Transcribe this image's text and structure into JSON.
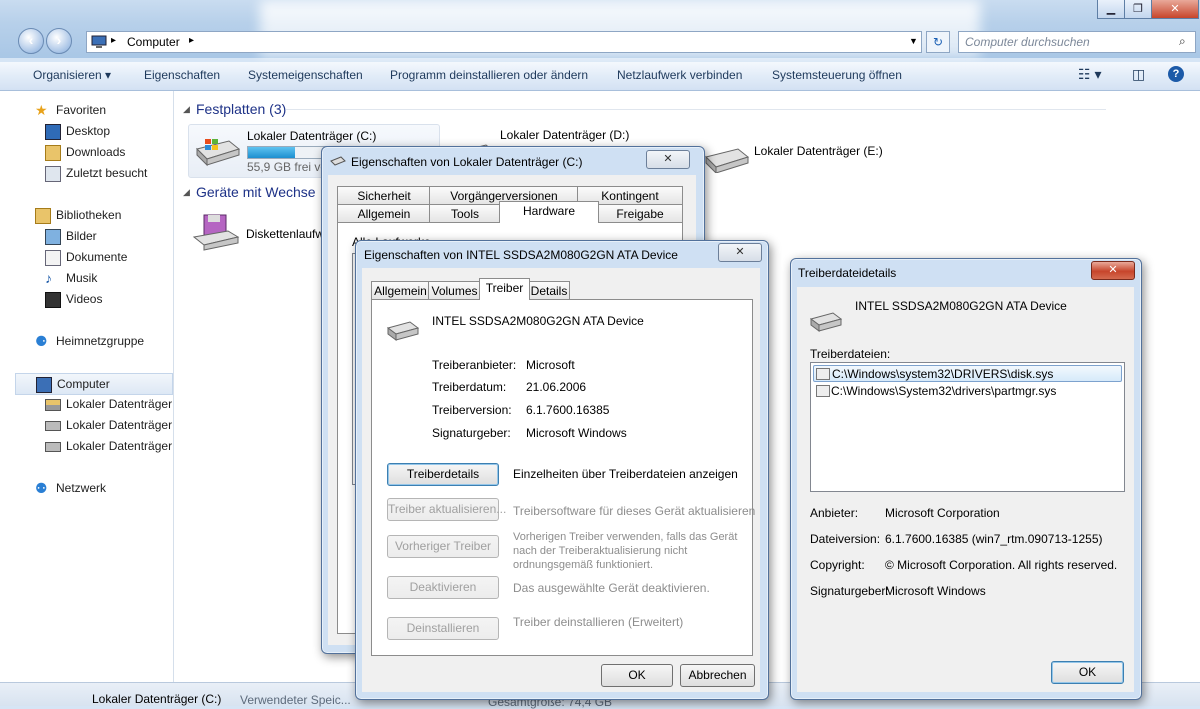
{
  "explorer": {
    "address": "Computer",
    "search_placeholder": "Computer durchsuchen",
    "toolbar": [
      "Organisieren",
      "Eigenschaften",
      "Systemeigenschaften",
      "Programm deinstallieren oder ändern",
      "Netzlaufwerk verbinden",
      "Systemsteuerung öffnen"
    ],
    "sidebar": {
      "favorites": "Favoriten",
      "desktop": "Desktop",
      "downloads": "Downloads",
      "recent": "Zuletzt besucht",
      "libraries": "Bibliotheken",
      "pictures": "Bilder",
      "documents": "Dokumente",
      "music": "Musik",
      "videos": "Videos",
      "homegroup": "Heimnetzgruppe",
      "computer": "Computer",
      "drive1": "Lokaler Datenträger",
      "drive2": "Lokaler Datenträger",
      "drive3": "Lokaler Datenträger",
      "network": "Netzwerk"
    },
    "groups": {
      "hdd_title": "Festplatten (3)",
      "removable_title": "Geräte mit Wechse"
    },
    "drives": {
      "c_name": "Lokaler Datenträger (C:)",
      "c_free": "55,9 GB frei vo",
      "c_fill": 0.25,
      "d_name": "Lokaler Datenträger (D:)",
      "e_name": "Lokaler Datenträger (E:)",
      "floppy": "Diskettenlaufw"
    },
    "status": {
      "name": "Lokaler Datenträger (C:)",
      "used": "Verwendeter Speic...",
      "total": "Gesamtgröße: 74,4 GB"
    }
  },
  "dlg1": {
    "title": "Eigenschaften von Lokaler Datenträger (C:)",
    "tabs_row1": [
      "Sicherheit",
      "Vorgängerversionen",
      "Kontingent"
    ],
    "tabs_row2": [
      "Allgemein",
      "Tools",
      "Hardware",
      "Freigabe"
    ],
    "partial_text": "Alle Laufwerke"
  },
  "dlg2": {
    "title": "Eigenschaften von INTEL SSDSA2M080G2GN ATA Device",
    "tabs": [
      "Allgemein",
      "Volumes",
      "Treiber",
      "Details"
    ],
    "device_name": "INTEL SSDSA2M080G2GN ATA Device",
    "info": [
      {
        "label": "Treiberanbieter:",
        "value": "Microsoft"
      },
      {
        "label": "Treiberdatum:",
        "value": "21.06.2006"
      },
      {
        "label": "Treiberversion:",
        "value": "6.1.7600.16385"
      },
      {
        "label": "Signaturgeber:",
        "value": "Microsoft Windows"
      }
    ],
    "actions": [
      {
        "button": "Treiberdetails",
        "desc": "Einzelheiten über Treiberdateien anzeigen"
      },
      {
        "button": "Treiber aktualisieren...",
        "desc": "Treibersoftware für dieses Gerät aktualisieren"
      },
      {
        "button": "Vorheriger Treiber",
        "desc1": "Vorherigen Treiber verwenden, falls das Gerät",
        "desc2": "nach der Treiberaktualisierung nicht",
        "desc3": "ordnungsgemäß funktioniert."
      },
      {
        "button": "Deaktivieren",
        "desc": "Das ausgewählte Gerät deaktivieren."
      },
      {
        "button": "Deinstallieren",
        "desc": "Treiber deinstallieren (Erweitert)"
      }
    ],
    "ok": "OK",
    "cancel": "Abbrechen"
  },
  "dlg3": {
    "title": "Treiberdateidetails",
    "device_name": "INTEL SSDSA2M080G2GN ATA Device",
    "files_label": "Treiberdateien:",
    "files": [
      "C:\\Windows\\system32\\DRIVERS\\disk.sys",
      "C:\\Windows\\System32\\drivers\\partmgr.sys"
    ],
    "info": [
      {
        "label": "Anbieter:",
        "value": "Microsoft Corporation"
      },
      {
        "label": "Dateiversion:",
        "value": "6.1.7600.16385 (win7_rtm.090713-1255)"
      },
      {
        "label": "Copyright:",
        "value": "© Microsoft Corporation. All rights reserved."
      },
      {
        "label": "Signaturgeber:",
        "value": "Microsoft Windows"
      }
    ],
    "ok": "OK"
  },
  "colors": {
    "accent": "#1e3287",
    "drive_bar": "#26a0da",
    "close_red": "#c7452b"
  }
}
